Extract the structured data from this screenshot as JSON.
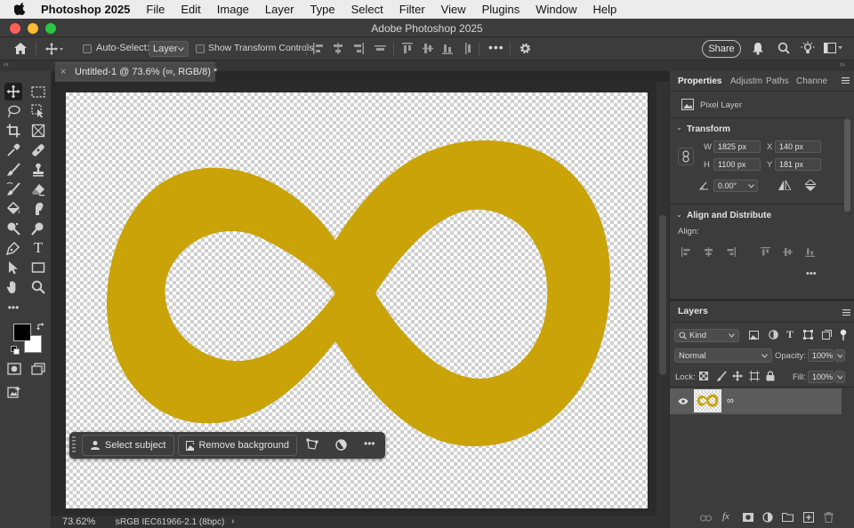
{
  "menubar": {
    "app_name": "Photoshop 2025",
    "items": [
      "File",
      "Edit",
      "Image",
      "Layer",
      "Type",
      "Select",
      "Filter",
      "View",
      "Plugins",
      "Window",
      "Help"
    ]
  },
  "window": {
    "title": "Adobe Photoshop 2025"
  },
  "options": {
    "auto_select_label": "Auto-Select:",
    "auto_select_value": "Layer",
    "show_transform_label": "Show Transform Controls",
    "share_label": "Share"
  },
  "document": {
    "tab_title": "Untitled-1 @ 73.6% (∞, RGB/8) *",
    "zoom": "73.62%",
    "color_profile": "sRGB IEC61966-2.1 (8bpc)",
    "artwork_color": "#C9A308"
  },
  "context_bar": {
    "select_subject": "Select subject",
    "remove_background": "Remove background"
  },
  "properties": {
    "tabs": [
      "Properties",
      "Adjustm",
      "Paths",
      "Channe"
    ],
    "layer_type": "Pixel Layer",
    "transform_title": "Transform",
    "w_label": "W",
    "w_value": "1825 px",
    "h_label": "H",
    "h_value": "1100 px",
    "x_label": "X",
    "x_value": "140 px",
    "y_label": "Y",
    "y_value": "181 px",
    "angle_value": "0.00°",
    "align_title": "Align and Distribute",
    "align_label": "Align:"
  },
  "layers": {
    "title": "Layers",
    "kind_label": "Kind",
    "blend_mode": "Normal",
    "opacity_label": "Opacity:",
    "opacity_value": "100%",
    "lock_label": "Lock:",
    "fill_label": "Fill:",
    "fill_value": "100%",
    "items": [
      {
        "name": "∞"
      }
    ]
  },
  "colors": {
    "foreground": "#000000",
    "background": "#FFFFFF",
    "accent": "#C9A308"
  }
}
